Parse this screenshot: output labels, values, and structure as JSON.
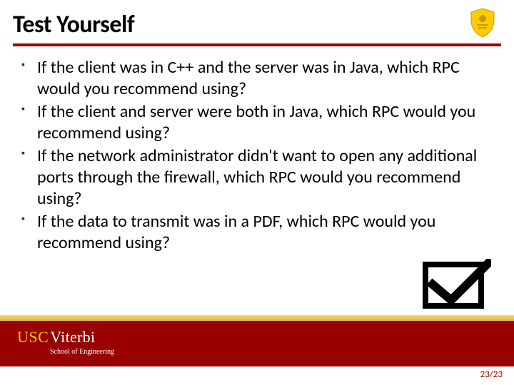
{
  "title": "Test Yourself",
  "bullets": [
    "If the client was in C++ and the server was in Java, which RPC would you recommend using?",
    "If the client and server were both in Java, which RPC would you recommend using?",
    "If the network administrator didn't want to open any additional ports through the firewall, which RPC would you recommend using?",
    "If the data to transmit was in a PDF, which RPC would you recommend using?"
  ],
  "logo": {
    "usc": "USC",
    "viterbi": "Viterbi",
    "school": "School of Engineering"
  },
  "page": "23/23"
}
